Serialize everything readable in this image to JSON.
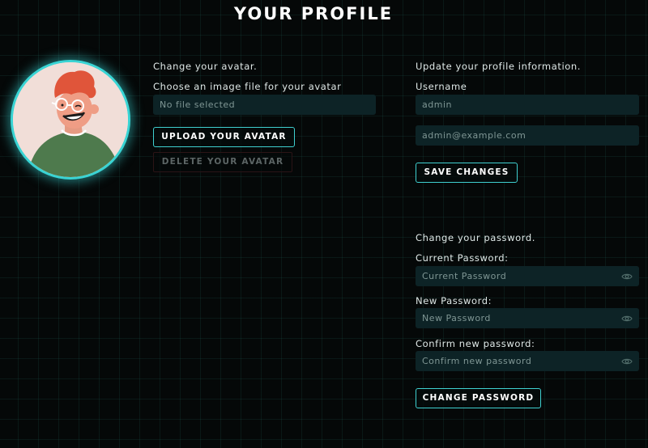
{
  "page": {
    "title": "YOUR PROFILE"
  },
  "avatar_section": {
    "heading": "Change your avatar.",
    "file_label": "Choose an image file for your avatar",
    "file_value": "No file selected",
    "upload_label": "UPLOAD YOUR AVATAR",
    "delete_label": "DELETE YOUR AVATAR",
    "avatar_icon": "person-avatar-illustration"
  },
  "profile_section": {
    "heading": "Update your profile information.",
    "username_label": "Username",
    "username_value": "admin",
    "email_placeholder": "admin@example.com",
    "save_label": "SAVE CHANGES"
  },
  "password_section": {
    "heading": "Change your password.",
    "current_label": "Current Password:",
    "current_placeholder": "Current Password",
    "new_label": "New Password:",
    "new_placeholder": "New Password",
    "confirm_label": "Confirm new password:",
    "confirm_placeholder": "Confirm new password",
    "change_label": "CHANGE PASSWORD",
    "eye_icon": "eye-icon"
  },
  "colors": {
    "background": "#050808",
    "accent": "#39d4d4",
    "input_bg": "#0d2326",
    "avatar_shirt": "#4e7a4d",
    "avatar_hair": "#e0553a"
  }
}
